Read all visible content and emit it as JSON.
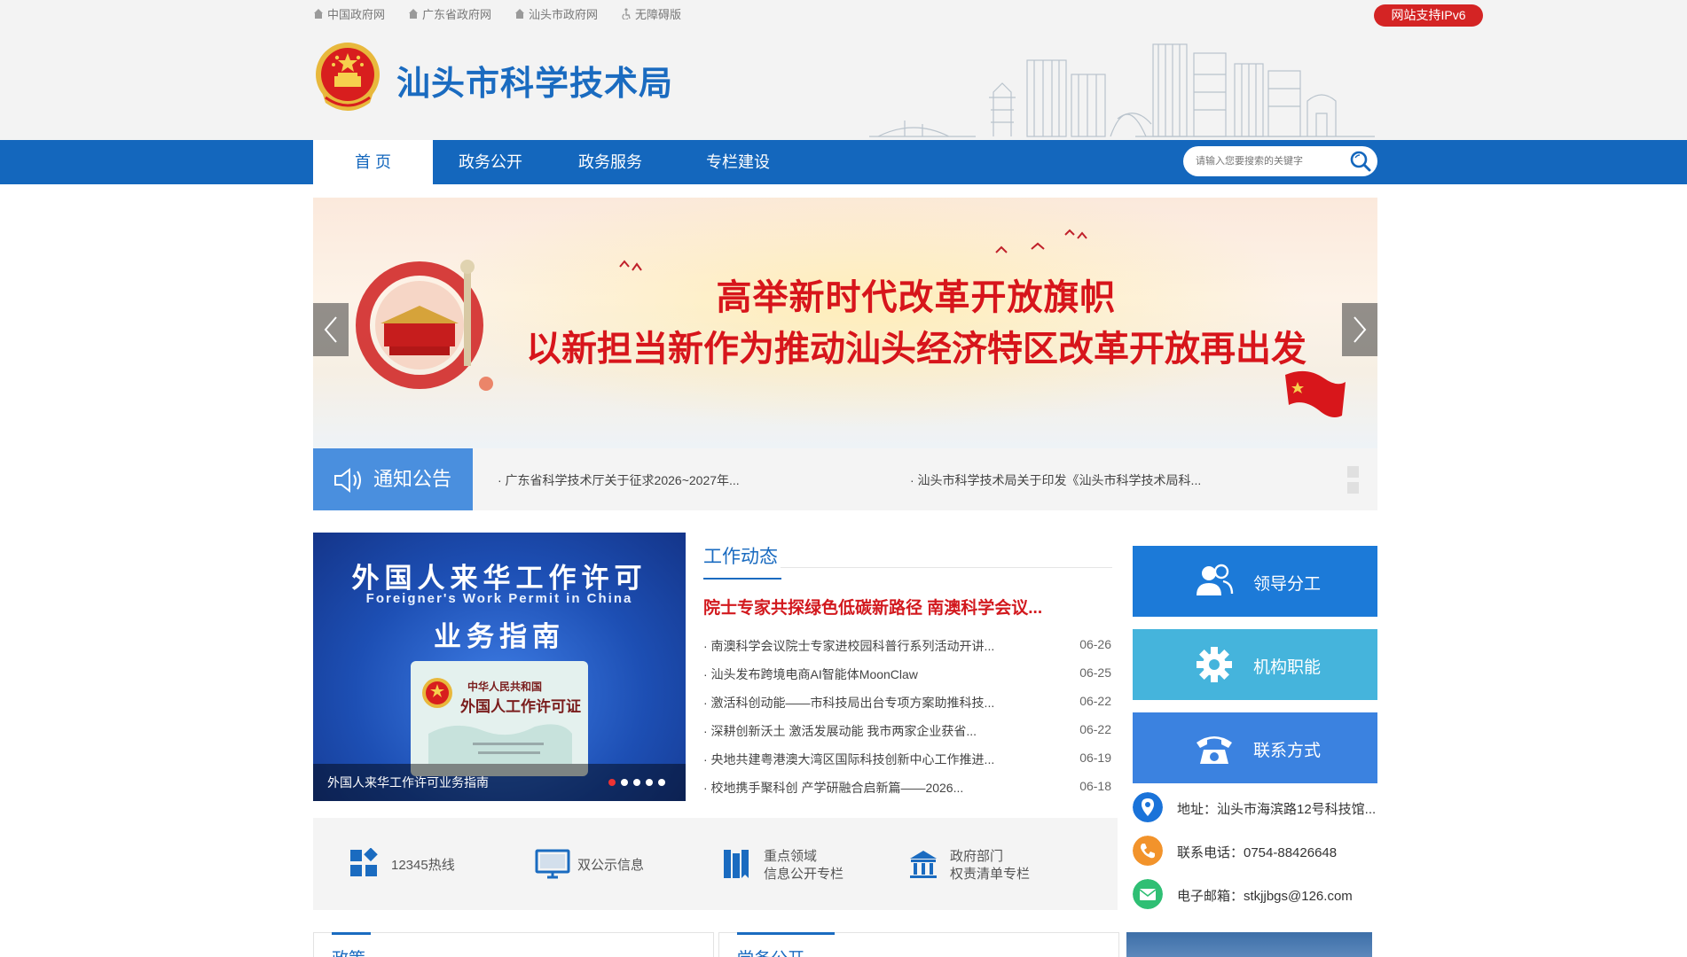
{
  "top_links": [
    "中国政府网",
    "广东省政府网",
    "汕头市政府网",
    "无障碍版"
  ],
  "ipv6_badge": "网站支持IPv6",
  "site_title": "汕头市科学技术局",
  "nav": [
    "首 页",
    "政务公开",
    "政务服务",
    "专栏建设"
  ],
  "search": {
    "placeholder": "请输入您要搜索的关键字"
  },
  "banner": {
    "line1": "高举新时代改革开放旗帜",
    "line2": "以新担当新作为推动汕头经济特区改革开放再出发"
  },
  "notice": {
    "title": "通知公告",
    "items": [
      "· 广东省科学技术厅关于征求2026~2027年...",
      "· 汕头市科学技术局关于印发《汕头市科学技术局科..."
    ]
  },
  "feature": {
    "title_cn": "外国人来华工作许可",
    "title_en": "Foreigner's Work Permit in China",
    "title_sub": "业务指南",
    "card_line1": "中华人民共和国",
    "card_line2": "外国人工作许可证",
    "caption": "外国人来华工作许可业务指南"
  },
  "news": {
    "heading": "工作动态",
    "headline": "院士专家共探绿色低碳新路径 南澳科学会议...",
    "items": [
      {
        "title": "· 南澳科学会议院士专家进校园科普行系列活动开讲...",
        "date": "06-26"
      },
      {
        "title": "· 汕头发布跨境电商AI智能体MoonClaw",
        "date": "06-25"
      },
      {
        "title": "· 激活科创动能——市科技局出台专项方案助推科技...",
        "date": "06-22"
      },
      {
        "title": "· 深耕创新沃土 激活发展动能 我市两家企业获省...",
        "date": "06-22"
      },
      {
        "title": "· 央地共建粤港澳大湾区国际科技创新中心工作推进...",
        "date": "06-19"
      },
      {
        "title": "· 校地携手聚科创 产学研融合启新篇——2026...",
        "date": "06-18"
      }
    ]
  },
  "right_buttons": [
    {
      "label": "领导分工",
      "color": "#1c7ad8"
    },
    {
      "label": "机构职能",
      "color": "#45b4dc"
    },
    {
      "label": "联系方式",
      "color": "#3b82e0"
    }
  ],
  "contacts": [
    {
      "text": "地址：汕头市海滨路12号科技馆...",
      "icon": "location-icon",
      "color": "#1a73d9"
    },
    {
      "text": "联系电话：0754-88426648",
      "icon": "phone-icon",
      "color": "#f2932b"
    },
    {
      "text": "电子邮箱：stkjjbgs@126.com",
      "icon": "mail-icon",
      "color": "#2fbf74"
    }
  ],
  "quick_links": [
    {
      "line1": "12345热线",
      "line2": "",
      "icon": "grid-icon"
    },
    {
      "line1": "双公示信息",
      "line2": "",
      "icon": "monitor-icon"
    },
    {
      "line1": "重点领域",
      "line2": "信息公开专栏",
      "icon": "book-icon"
    },
    {
      "line1": "政府部门",
      "line2": "权责清单专栏",
      "icon": "government-building-icon"
    }
  ],
  "panels": [
    "政策",
    "党务公开"
  ],
  "colors": {
    "brand_blue": "#1467bd",
    "title_blue": "#1a6bc0",
    "headline_red": "#d2191e",
    "badge_red": "#d42424"
  }
}
